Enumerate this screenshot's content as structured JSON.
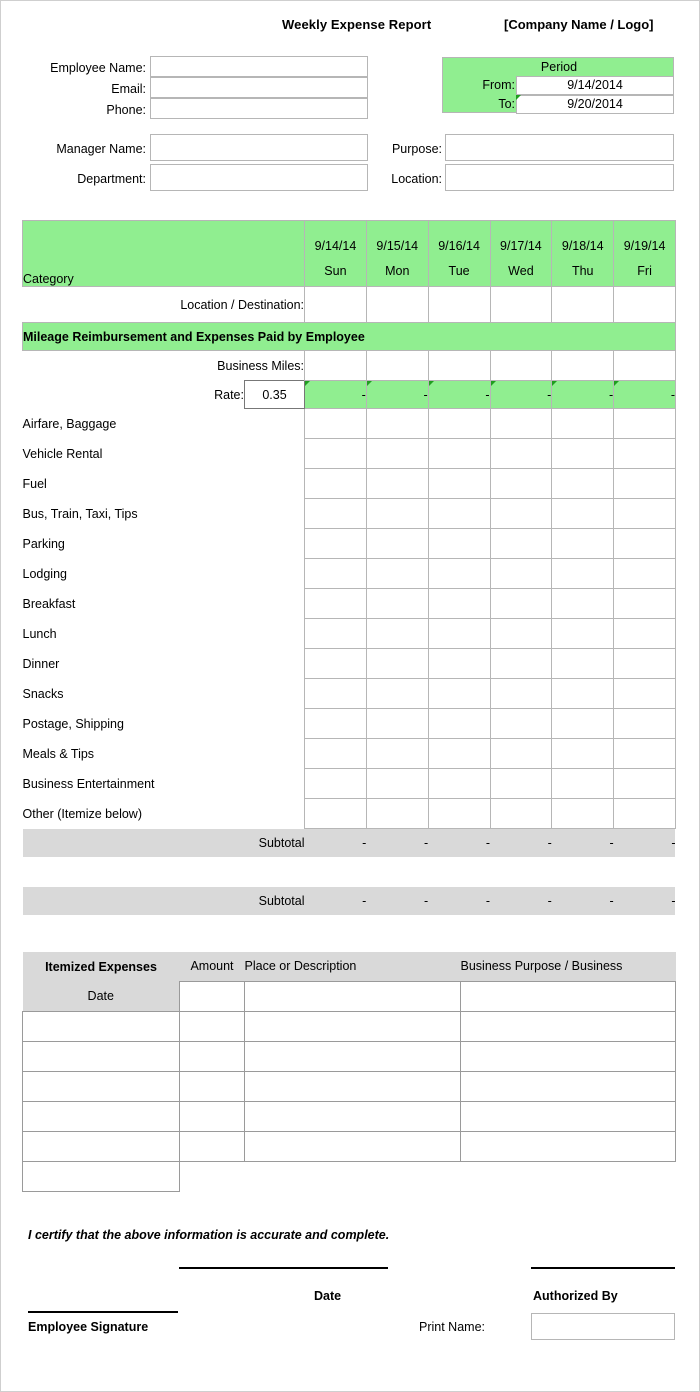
{
  "header": {
    "title": "Weekly Expense Report",
    "company": "[Company Name / Logo]"
  },
  "employee_form": {
    "employee_name_label": "Employee Name:",
    "employee_name_value": "",
    "email_label": "Email:",
    "email_value": "",
    "phone_label": "Phone:",
    "phone_value": "",
    "manager_name_label": "Manager Name:",
    "manager_name_value": "",
    "department_label": "Department:",
    "department_value": "",
    "purpose_label": "Purpose:",
    "purpose_value": "",
    "location_label": "Location:",
    "location_value": ""
  },
  "period": {
    "title": "Period",
    "from_label": "From:",
    "from_value": "9/14/2014",
    "to_label": "To:",
    "to_value": "9/20/2014"
  },
  "main_table": {
    "category_header": "Category",
    "days": [
      {
        "date": "9/14/14",
        "day": "Sun"
      },
      {
        "date": "9/15/14",
        "day": "Mon"
      },
      {
        "date": "9/16/14",
        "day": "Tue"
      },
      {
        "date": "9/17/14",
        "day": "Wed"
      },
      {
        "date": "9/18/14",
        "day": "Thu"
      },
      {
        "date": "9/19/14",
        "day": "Fri"
      }
    ],
    "location_row_label": "Location / Destination:",
    "mileage_band": "Mileage Reimbursement and Expenses Paid by Employee",
    "business_miles_label": "Business Miles:",
    "rate_label": "Rate:",
    "rate_value": "0.35",
    "rate_results": [
      "-",
      "-",
      "-",
      "-",
      "-",
      "-"
    ],
    "categories": [
      "Airfare, Baggage",
      "Vehicle Rental",
      "Fuel",
      "Bus, Train, Taxi, Tips",
      "Parking",
      "Lodging",
      "Breakfast",
      "Lunch",
      "Dinner",
      "Snacks",
      "Postage, Shipping",
      "Meals & Tips",
      "Business Entertainment",
      "Other (Itemize below)"
    ],
    "subtotal_label": "Subtotal",
    "subtotal_values_1": [
      "-",
      "-",
      "-",
      "-",
      "-",
      "-"
    ],
    "subtotal_values_2": [
      "-",
      "-",
      "-",
      "-",
      "-",
      "-"
    ]
  },
  "itemized": {
    "title": "Itemized Expenses",
    "amount_header": "Amount",
    "place_header": "Place or Description",
    "purpose_header": "Business Purpose / Business",
    "date_label": "Date",
    "rows": [
      {
        "date": "",
        "amount": "",
        "place": "",
        "purpose": ""
      },
      {
        "date": "",
        "amount": "",
        "place": "",
        "purpose": ""
      },
      {
        "date": "",
        "amount": "",
        "place": "",
        "purpose": ""
      },
      {
        "date": "",
        "amount": "",
        "place": "",
        "purpose": ""
      },
      {
        "date": "",
        "amount": "",
        "place": "",
        "purpose": ""
      }
    ]
  },
  "signature": {
    "certify_text": "I certify that the above information is accurate and complete.",
    "employee_signature_label": "Employee Signature",
    "date_label": "Date",
    "authorized_by_label": "Authorized By",
    "print_name_label": "Print Name:",
    "print_name_value": ""
  },
  "colors": {
    "green_header": "#90ee90",
    "green_bright": "#5fe05f",
    "gray_subtotal": "#d9d9d9",
    "border": "#b6b6b6",
    "comment_marker": "#1f9e1f"
  }
}
